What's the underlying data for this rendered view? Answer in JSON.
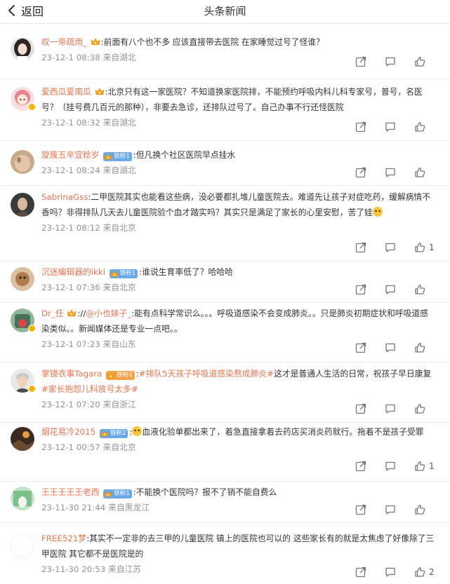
{
  "header": {
    "back_label": "返回",
    "title": "头条新闻"
  },
  "comments": [
    {
      "user": "叹一帝疏雨_",
      "sep": ":",
      "body": "前面有八个也不多 应该直接带去医院 在家睡觉过号了怪谁？",
      "meta": "23-12-1 08:38 来自湖北",
      "likes": ""
    },
    {
      "user": "爱西瓜爱南瓜",
      "sep": ":",
      "body": "北京只有这一家医院？不知道换家医院排，不能预约呼吸内科儿科专家号，普号，名医号？（挂号费几百元的那种），非要去急诊，还排队过号了。自己办事不行还怪医院",
      "meta": "23-12-1 08:32 来自湖北",
      "likes": ""
    },
    {
      "user": "旋簇五辛宜稔岁",
      "badge": "铁粉1",
      "sep": ":",
      "body": "但凡换个社区医院早点挂水",
      "meta": "23-12-1 08:24 来自湖北",
      "likes": ""
    },
    {
      "user": "SabrinaGss",
      "sep": ":",
      "body": "二甲医院其实也能看这些病，没必要都扎堆儿童医院去。难道先让孩子对症吃药，缓解病情不香吗？非得排队几天去儿童医院验个血才踏实吗？其实只是满足了家长的心里安慰，苦了娃",
      "meta": "23-12-1 08:12 来自北京",
      "likes": "1"
    },
    {
      "user": "沉迷编辑器的ikki",
      "badge": "铁粉1",
      "sep": ":",
      "body": "谁说生育率低了？哈哈哈",
      "meta": "23-12-1 07:36 来自北京",
      "likes": ""
    },
    {
      "user": "Dr_任",
      "sep": ":",
      "reply_prefix": "//",
      "mention": "@小也妹子_",
      "body": ":能有点科学常识么。。。呼吸道感染不会变成肺炎。。只是肺炎初期症状和呼吸道感染类似。。新闻媒体还是专业一点吧。。",
      "meta": "23-12-1 07:23 来自山东",
      "likes": ""
    },
    {
      "user": "掌镜衣事Tagara",
      "badge": "铁粉2",
      "badge_color": "orange",
      "sep": ":",
      "hashtag1": "#排队5天孩子呼吸道感染熬成肺炎#",
      "body": "这才是普通人生活的日常，祝孩子早日康复",
      "hashtag2": "#家长抱怨儿科放号太多#",
      "meta": "23-12-1 07:20 来自浙江",
      "likes": ""
    },
    {
      "user": "烟花易冷2015",
      "badge": "铁粉2",
      "sep": ":",
      "body": "血液化验单都出来了，着急直接拿着去药店买消炎药就行。拖着不是孩子受罪",
      "meta": "23-12-1 00:57 来自北京",
      "likes": "1"
    },
    {
      "user": "王王王王王老西",
      "badge": "铁粉1",
      "sep": ":",
      "body": "不能换个医院吗？报不了销不能自费么",
      "meta": "23-11-30 21:44 来自黑龙江",
      "likes": ""
    },
    {
      "user": "FREE521梦",
      "sep": ":",
      "body": "其实不一定非的去三甲的儿童医院 镇上的医院也可以的 这些家长有的就是太焦虑了好像除了三甲医院 其它都不是医院是的",
      "meta": "23-11-30 20:53 来自江苏",
      "likes": "2"
    }
  ]
}
